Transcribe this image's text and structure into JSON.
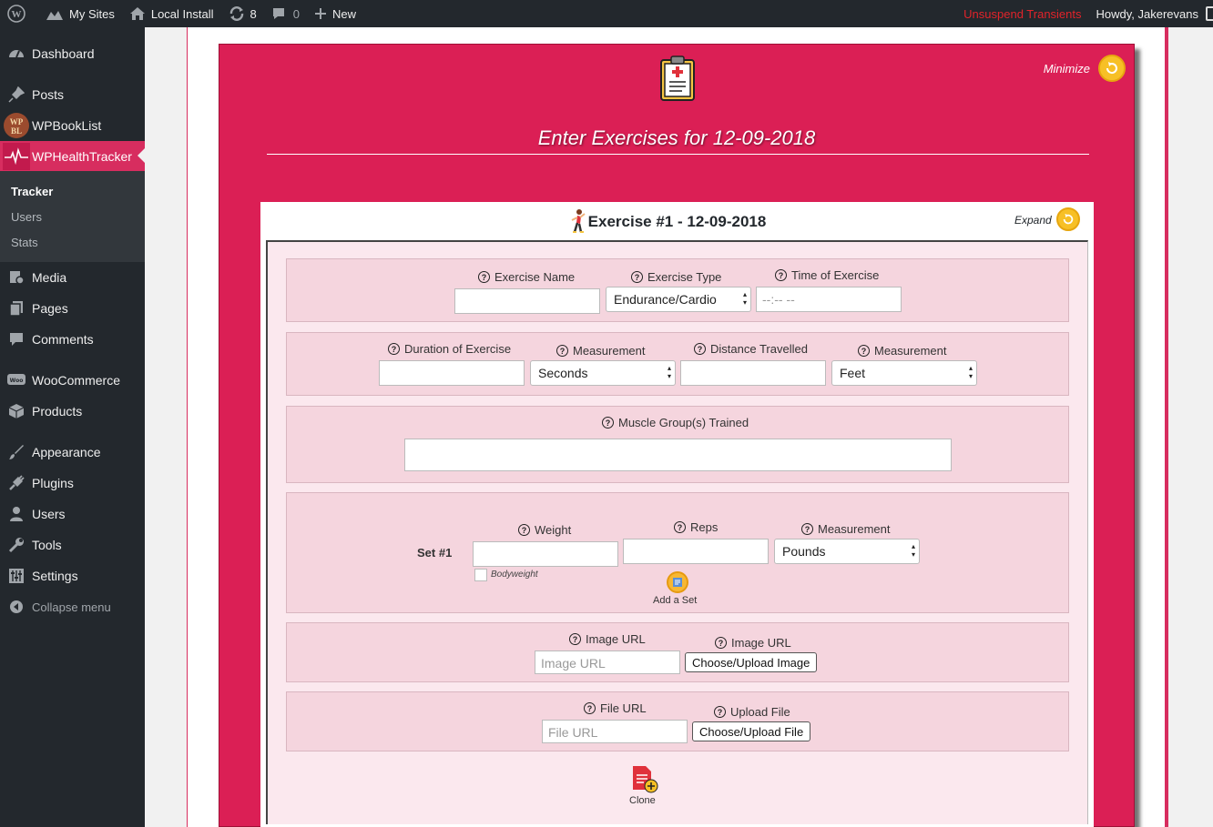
{
  "adminbar": {
    "my_sites": "My Sites",
    "site_name": "Local Install",
    "updates_count": "8",
    "comments_count": "0",
    "new_label": "New",
    "unsuspend": "Unsuspend Transients",
    "howdy": "Howdy, Jakerevans",
    "accent_color": "#e2232a"
  },
  "sidebar": {
    "items": [
      {
        "label": "Dashboard",
        "icon": "dashboard-icon"
      },
      {
        "label": "Posts",
        "icon": "pin-icon"
      },
      {
        "label": "WPBookList",
        "icon": "wpbooklist-logo-icon"
      },
      {
        "label": "WPHealthTracker",
        "icon": "heartbeat-icon"
      },
      {
        "label": "Media",
        "icon": "media-icon"
      },
      {
        "label": "Pages",
        "icon": "pages-icon"
      },
      {
        "label": "Comments",
        "icon": "comment-icon"
      },
      {
        "label": "WooCommerce",
        "icon": "woo-icon"
      },
      {
        "label": "Products",
        "icon": "box-icon"
      },
      {
        "label": "Appearance",
        "icon": "brush-icon"
      },
      {
        "label": "Plugins",
        "icon": "plug-icon"
      },
      {
        "label": "Users",
        "icon": "user-icon"
      },
      {
        "label": "Tools",
        "icon": "wrench-icon"
      },
      {
        "label": "Settings",
        "icon": "sliders-icon"
      }
    ],
    "submenu": [
      "Tracker",
      "Users",
      "Stats"
    ],
    "collapse": "Collapse menu",
    "active_color": "#d72d5f"
  },
  "panel": {
    "minimize": "Minimize",
    "title": "Enter Exercises for 12-09-2018",
    "bg_color": "#db1f55"
  },
  "exercise": {
    "title": "Exercise #1 - 12-09-2018",
    "expand": "Expand",
    "row1": {
      "name_label": "Exercise Name",
      "name_value": "",
      "type_label": "Exercise Type",
      "type_value": "Endurance/Cardio",
      "time_label": "Time of Exercise",
      "time_value": "--:-- --"
    },
    "row2": {
      "duration_label": "Duration of Exercise",
      "duration_value": "",
      "measurement_label": "Measurement",
      "measurement_value": "Seconds",
      "distance_label": "Distance Travelled",
      "distance_value": "",
      "measurement2_label": "Measurement",
      "measurement2_value": "Feet"
    },
    "row3": {
      "muscle_label": "Muscle Group(s) Trained",
      "muscle_value": ""
    },
    "row4": {
      "set_label": "Set #1",
      "weight_label": "Weight",
      "reps_label": "Reps",
      "measurement_label": "Measurement",
      "measurement_value": "Pounds",
      "bodyweight": "Bodyweight",
      "add_set": "Add a Set"
    },
    "row5": {
      "image_url_label": "Image URL",
      "image_url_placeholder": "Image URL",
      "image_button_label": "Image URL",
      "image_button": "Choose/Upload Image"
    },
    "row6": {
      "file_url_label": "File URL",
      "file_url_placeholder": "File URL",
      "upload_label": "Upload File",
      "upload_button": "Choose/Upload File"
    },
    "clone": "Clone"
  }
}
